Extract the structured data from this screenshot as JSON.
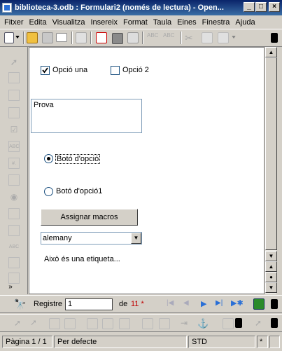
{
  "window": {
    "title": "biblioteca-3.odb : Formulari2 (només de lectura) - Open...",
    "min_label": "_",
    "max_label": "□",
    "close_label": "×"
  },
  "menu": [
    "Fitxer",
    "Edita",
    "Visualitza",
    "Insereix",
    "Format",
    "Taula",
    "Eines",
    "Finestra",
    "Ajuda"
  ],
  "form": {
    "checkbox1_label": "Opció una",
    "checkbox1_checked": true,
    "checkbox2_label": "Opció 2",
    "checkbox2_checked": false,
    "textarea_value": "Prova",
    "radio1_label": "Botó d'opció",
    "radio1_selected": true,
    "radio2_label": "Botó d'opció1",
    "button_label": "Assignar macros",
    "combo_value": "alemany",
    "static_label": "Això és una etiqueta..."
  },
  "navigation": {
    "record_label": "Registre",
    "record_value": "1",
    "of_label": "de",
    "total": "11 *"
  },
  "status": {
    "page": "Pàgina  1 / 1",
    "style": "Per defecte",
    "mode": "STD",
    "star": "*"
  },
  "colors": {
    "titlebar_start": "#0a246a",
    "titlebar_end": "#3a6ea5",
    "chrome": "#d4d0c8",
    "input_border": "#7f9db9",
    "total_red": "#c00000"
  }
}
